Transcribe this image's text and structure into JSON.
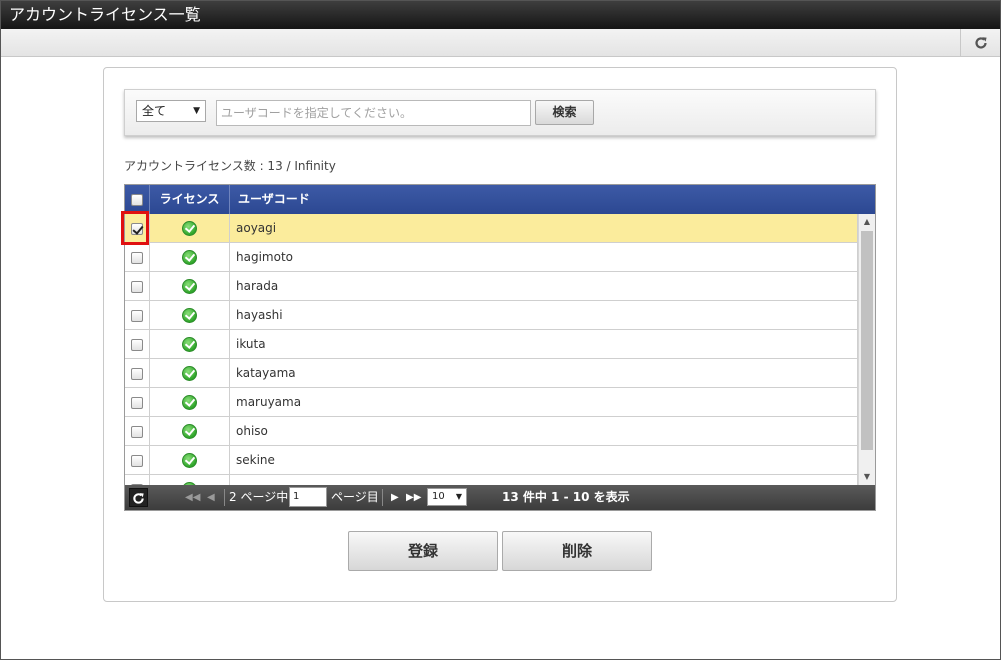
{
  "window": {
    "title": "アカウントライセンス一覧"
  },
  "toolbar": {
    "refresh_icon": "refresh-icon"
  },
  "search": {
    "filter_value": "全て",
    "placeholder": "ユーザコードを指定してください。",
    "button_label": "検索"
  },
  "license_count": "アカウントライセンス数 : 13 / Infinity",
  "table": {
    "headers": {
      "license": "ライセンス",
      "user_code": "ユーザコード"
    },
    "rows": [
      {
        "user": "aoyagi",
        "checked": true
      },
      {
        "user": "hagimoto",
        "checked": false
      },
      {
        "user": "harada",
        "checked": false
      },
      {
        "user": "hayashi",
        "checked": false
      },
      {
        "user": "ikuta",
        "checked": false
      },
      {
        "user": "katayama",
        "checked": false
      },
      {
        "user": "maruyama",
        "checked": false
      },
      {
        "user": "ohiso",
        "checked": false
      },
      {
        "user": "sekine",
        "checked": false
      },
      {
        "user": "",
        "checked": false
      }
    ]
  },
  "pager": {
    "page_prefix": "2 ページ中",
    "current_page": "1",
    "page_suffix": "ページ目",
    "page_size": "10",
    "summary": "13 件中 1 - 10 を表示"
  },
  "actions": {
    "register_label": "登録",
    "delete_label": "削除"
  },
  "colors": {
    "header_blue": "#2c4892",
    "selected_row": "#fbec9c",
    "highlight_red": "#e01010",
    "license_ok_green": "#2fa52a"
  }
}
